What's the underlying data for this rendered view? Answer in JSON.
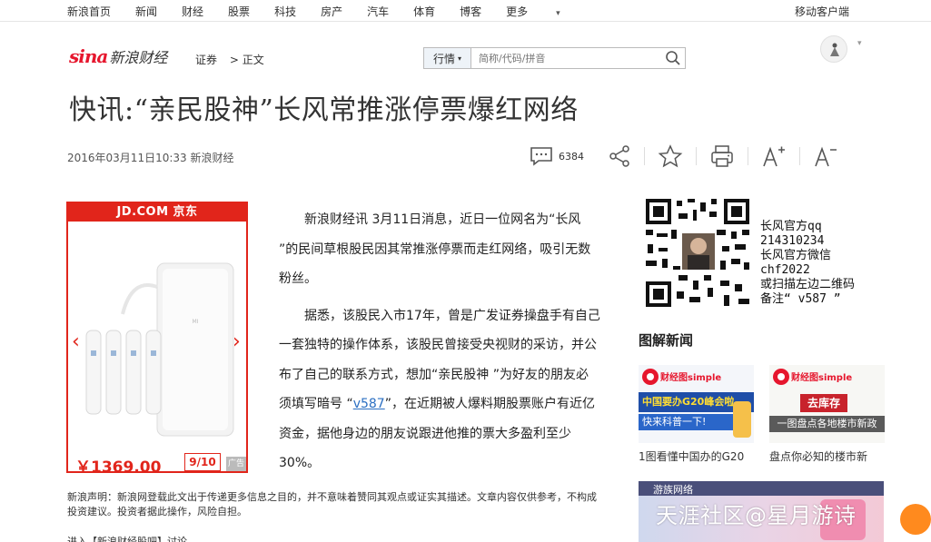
{
  "topnav": {
    "items": [
      "新浪首页",
      "新闻",
      "财经",
      "股票",
      "科技",
      "房产",
      "汽车",
      "体育",
      "博客",
      "更多"
    ],
    "mobile": "移动客户端"
  },
  "header": {
    "logo_brand": "sina",
    "logo_text": "新浪财经",
    "crumb1": "证券",
    "crumb2": "> 正文",
    "search_select": "行情",
    "search_placeholder": "简称/代码/拼音"
  },
  "article": {
    "title": "快讯:“亲民股神”长风常推涨停票爆红网络",
    "meta": "2016年03月11日10:33  新浪财经",
    "comment_count": "6384",
    "p1": "新浪财经讯 3月11日消息，近日一位网名为“长风 ”的民间草根股民因其常推涨停票而走红网络，吸引无数粉丝。",
    "p2_a": "据悉，该股民入市17年，曾是广发证券操盘手有自己一套独特的操作体系，该股民曾接受央视财的采访，并公布了自己的联系方式，想加“亲民股神 ”为好友的朋友必须填写暗号 “",
    "p2_code": "v587",
    "p2_b": "”，在近期被人爆料期股票账户有近亿资金，据他身边的朋友说跟进他推的票大多盈利至少30%。",
    "disclaimer": "新浪声明：新浪网登载此文出于传递更多信息之目的，并不意味着赞同其观点或证实其描述。文章内容仅供参考，不构成投资建议。投资者据此操作，风险自担。",
    "cutline": "进入【新浪财经股吧】讨论"
  },
  "ad": {
    "header": "JD.COM 京东",
    "price": "￥1369.00",
    "page": "9/10",
    "badge": "广告"
  },
  "sidebar": {
    "qr_lines": [
      "长风官方qq",
      "214310234",
      "长风官方微信",
      "chf2022",
      "或扫描左边二维码",
      "备注“ v587 ”"
    ],
    "section_title": "图解新闻",
    "cards": [
      {
        "brand": "财经图simple",
        "banner": "中国要办G20峰会啦",
        "sub": "快来科普一下!",
        "caption": "1图看懂中国办的G20"
      },
      {
        "brand": "财经图simple",
        "banner": "去库存",
        "sub": "一图盘点各地楼市新政",
        "caption": "盘点你必知的楼市新"
      }
    ],
    "bottom_brand": "游族网络",
    "watermark": "天涯社区@星月游诗"
  },
  "colors": {
    "accent_red": "#e6162d",
    "jd_red": "#e1251b",
    "link": "#2b6fc2"
  }
}
